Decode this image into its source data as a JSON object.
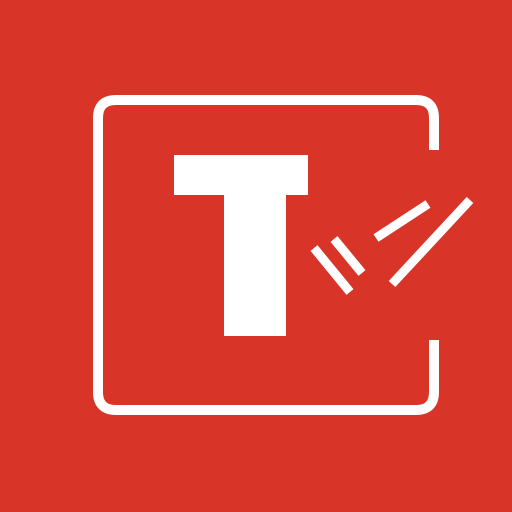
{
  "app_icon": {
    "background_color": "#d83428",
    "foreground_color": "#ffffff",
    "letter": "T",
    "icons": {
      "frame": "bracket-frame-icon",
      "letter": "letter-t-icon",
      "check": "double-check-icon"
    }
  }
}
